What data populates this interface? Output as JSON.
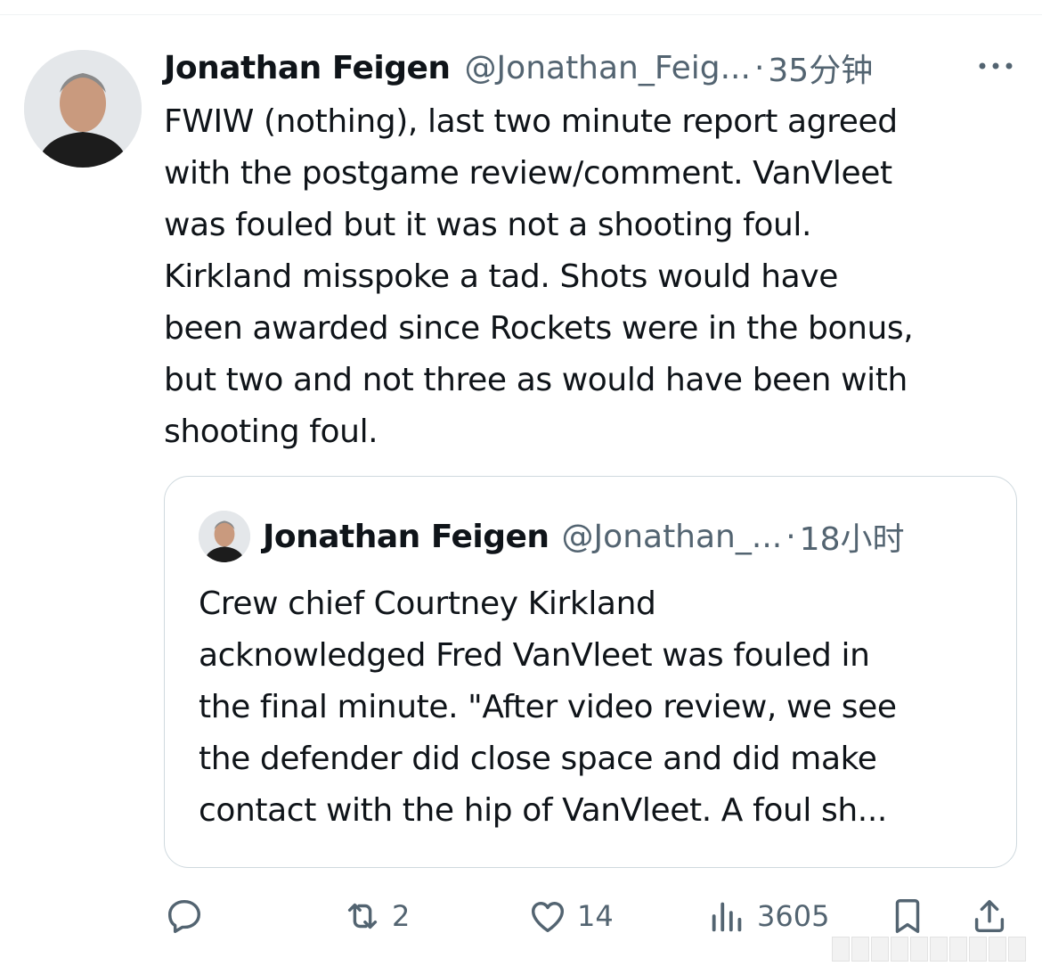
{
  "tweet": {
    "author_name": "Jonathan Feigen",
    "author_handle": "@Jonathan_Feig...",
    "separator": "·",
    "time_ago": "35分钟",
    "text": "FWIW (nothing), last two minute report agreed\nwith the postgame review/comment. VanVleet\nwas fouled but it was not a shooting foul.\nKirkland misspoke a tad. Shots would have\nbeen awarded since Rockets were in the bonus,\nbut two and not three as would have been with\nshooting foul."
  },
  "quote": {
    "author_name": "Jonathan Feigen",
    "author_handle": "@Jonathan_...",
    "separator": "·",
    "time_ago": "18小时",
    "text": "Crew chief Courtney Kirkland\nacknowledged Fred VanVleet was fouled in\nthe final minute. \"After video review, we see\nthe defender did close space and did make\ncontact with the hip of VanVleet. A foul sh..."
  },
  "actions": {
    "reply_icon": "reply-icon",
    "retweet_icon": "retweet-icon",
    "retweet_count": "2",
    "like_icon": "heart-icon",
    "like_count": "14",
    "views_icon": "views-icon",
    "views_count": "3605",
    "bookmark_icon": "bookmark-icon",
    "share_icon": "share-icon"
  },
  "colors": {
    "text": "#0f1419",
    "secondary": "#536471",
    "border": "#cfd9de"
  }
}
